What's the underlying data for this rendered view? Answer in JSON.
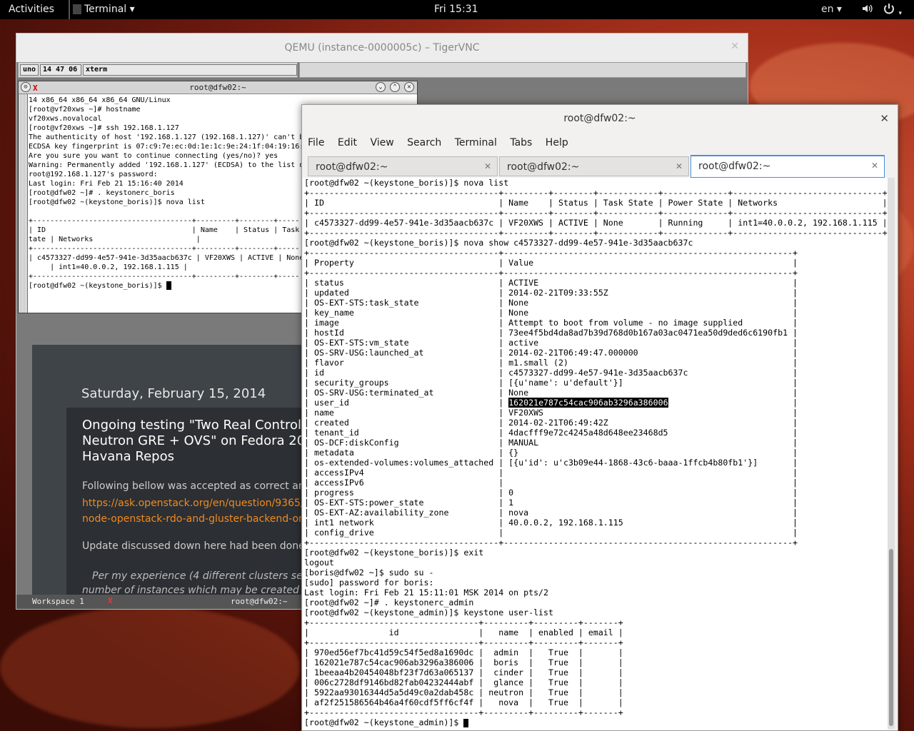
{
  "topbar": {
    "activities": "Activities",
    "app": "Terminal ▾",
    "clock": "Fri 15:31",
    "lang": "en ▾",
    "volume_icon": "speaker-icon",
    "power_icon": "power-icon"
  },
  "vnc": {
    "title": "QEMU (instance-0000005c) – TigerVNC",
    "twm_boxes": [
      "uno",
      "14 47 06",
      "xterm"
    ],
    "xterm": {
      "title": "root@dfw02:~",
      "lines": [
        "14 x86_64 x86_64 x86_64 GNU/Linux",
        "[root@vf20xws ~]# hostname",
        "vf20xws.novalocal",
        "[root@vf20xws ~]# ssh 192.168.1.127",
        "The authenticity of host '192.168.1.127 (192.168.1.127)' can't b",
        "ECDSA key fingerprint is 07:c9:7e:ec:0d:1e:1c:9e:24:1f:04:19:16:",
        "Are you sure you want to continue connecting (yes/no)? yes",
        "Warning: Permanently added '192.168.1.127' (ECDSA) to the list o",
        "root@192.168.1.127's password:",
        "Last login: Fri Feb 21 15:16:40 2014",
        "[root@dfw02 ~]# . keystonerc_boris",
        "[root@dfw02 ~(keystone_boris)]$ nova list",
        "",
        "+-------------------------------------+---------+--------+-----",
        "| ID                                  | Name    | Status | Task",
        "tate | Networks                        |",
        "+-------------------------------------+---------+--------+-----",
        "| c4573327-dd99-4e57-941e-3d35aacb637c | VF20XWS | ACTIVE | None",
        "     | int1=40.0.0.2, 192.168.1.115 |",
        "+-------------------------------------+---------+--------+-----",
        "[root@dfw02 ~(keystone_boris)]$ "
      ]
    },
    "blog": {
      "date": "Saturday, February 15, 2014",
      "title": "Ongoing testing \"Two Real Controller\nNeutron GRE + OVS\" on Fedora 20 b\nHavana Repos",
      "p1": "Following bellow was accepted as correct ans",
      "link1": "https://ask.openstack.org/en/question/9365/t",
      "link2": "node-openstack-rdo-and-gluster-backend-on-f",
      "p2": "Update discussed down here had been done",
      "p3a": "Per my experience (4 different clusters set",
      "p3b": "number of instances which may be created o"
    },
    "bottom_bar": {
      "workspace": "Workspace 1",
      "icon": "x-logo-icon",
      "title": "root@dfw02:~"
    }
  },
  "gterm": {
    "title": "root@dfw02:~",
    "menu": [
      "File",
      "Edit",
      "View",
      "Search",
      "Terminal",
      "Tabs",
      "Help"
    ],
    "tabs": [
      "root@dfw02:~",
      "root@dfw02:~",
      "root@dfw02:~"
    ],
    "lines_top": [
      "[root@dfw02 ~(keystone_boris)]$ nova list",
      "+--------------------------------------+---------+--------+------------+-------------+------------------------------+",
      "| ID                                   | Name    | Status | Task State | Power State | Networks                     |",
      "+--------------------------------------+---------+--------+------------+-------------+------------------------------+",
      "| c4573327-dd99-4e57-941e-3d35aacb637c | VF20XWS | ACTIVE | None       | Running     | int1=40.0.0.2, 192.168.1.115 |",
      "+--------------------------------------+---------+--------+------------+-------------+------------------------------+",
      "[root@dfw02 ~(keystone_boris)]$ nova show c4573327-dd99-4e57-941e-3d35aacb637c",
      "+--------------------------------------+----------------------------------------------------------+",
      "| Property                             | Value                                                    |",
      "+--------------------------------------+----------------------------------------------------------+",
      "| status                               | ACTIVE                                                   |",
      "| updated                              | 2014-02-21T09:33:55Z                                     |",
      "| OS-EXT-STS:task_state                | None                                                     |",
      "| key_name                             | None                                                     |",
      "| image                                | Attempt to boot from volume - no image supplied          |",
      "| hostId                               | 73ee4f5bd4da8ad7b39d768d0b167a03ac0471ea50d9ded6c6190fb1 |",
      "| OS-EXT-STS:vm_state                  | active                                                   |",
      "| OS-SRV-USG:launched_at               | 2014-02-21T06:49:47.000000                               |",
      "| flavor                               | m1.small (2)                                             |",
      "| id                                   | c4573327-dd99-4e57-941e-3d35aacb637c                     |",
      "| security_groups                      | [{u'name': u'default'}]                                  |",
      "| OS-SRV-USG:terminated_at             | None                                                     |"
    ],
    "user_id_pre": "| user_id                              | ",
    "user_id_val": "162021e787c54cac906ab3296a386006",
    "user_id_post": "                         |",
    "lines_bottom": [
      "| name                                 | VF20XWS                                                  |",
      "| created                              | 2014-02-21T06:49:42Z                                     |",
      "| tenant_id                            | 4dacfff9e72c4245a48d648ee23468d5                         |",
      "| OS-DCF:diskConfig                    | MANUAL                                                   |",
      "| metadata                             | {}                                                       |",
      "| os-extended-volumes:volumes_attached | [{u'id': u'c3b09e44-1868-43c6-baaa-1ffcb4b80fb1'}]       |",
      "| accessIPv4                           |                                                          |",
      "| accessIPv6                           |                                                          |",
      "| progress                             | 0                                                        |",
      "| OS-EXT-STS:power_state               | 1                                                        |",
      "| OS-EXT-AZ:availability_zone          | nova                                                     |",
      "| int1 network                         | 40.0.0.2, 192.168.1.115                                  |",
      "| config_drive                         |                                                          |",
      "+--------------------------------------+----------------------------------------------------------+",
      "[root@dfw02 ~(keystone_boris)]$ exit",
      "logout",
      "[boris@dfw02 ~]$ sudo su -",
      "[sudo] password for boris:",
      "Last login: Fri Feb 21 15:11:01 MSK 2014 on pts/2",
      "[root@dfw02 ~]# . keystonerc_admin",
      "[root@dfw02 ~(keystone_admin)]$ keystone user-list",
      "+----------------------------------+---------+---------+-------+",
      "|                id                |   name  | enabled | email |",
      "+----------------------------------+---------+---------+-------+",
      "| 970ed56ef7bc41d59c54f5ed8a1690dc |  admin  |   True  |       |",
      "| 162021e787c54cac906ab3296a386006 |  boris  |   True  |       |",
      "| 1beeaa4b20454048bf23f7d63a065137 |  cinder |   True  |       |",
      "| 006c2728df9146bd82fab04232444abf |  glance |   True  |       |",
      "| 5922aa93016344d5a5d49c0a2dab458c | neutron |   True  |       |",
      "| af2f251586564b46a4f60cdf5ff6cf4f |   nova  |   True  |       |",
      "+----------------------------------+---------+---------+-------+"
    ],
    "prompt": "[root@dfw02 ~(keystone_admin)]$ "
  }
}
